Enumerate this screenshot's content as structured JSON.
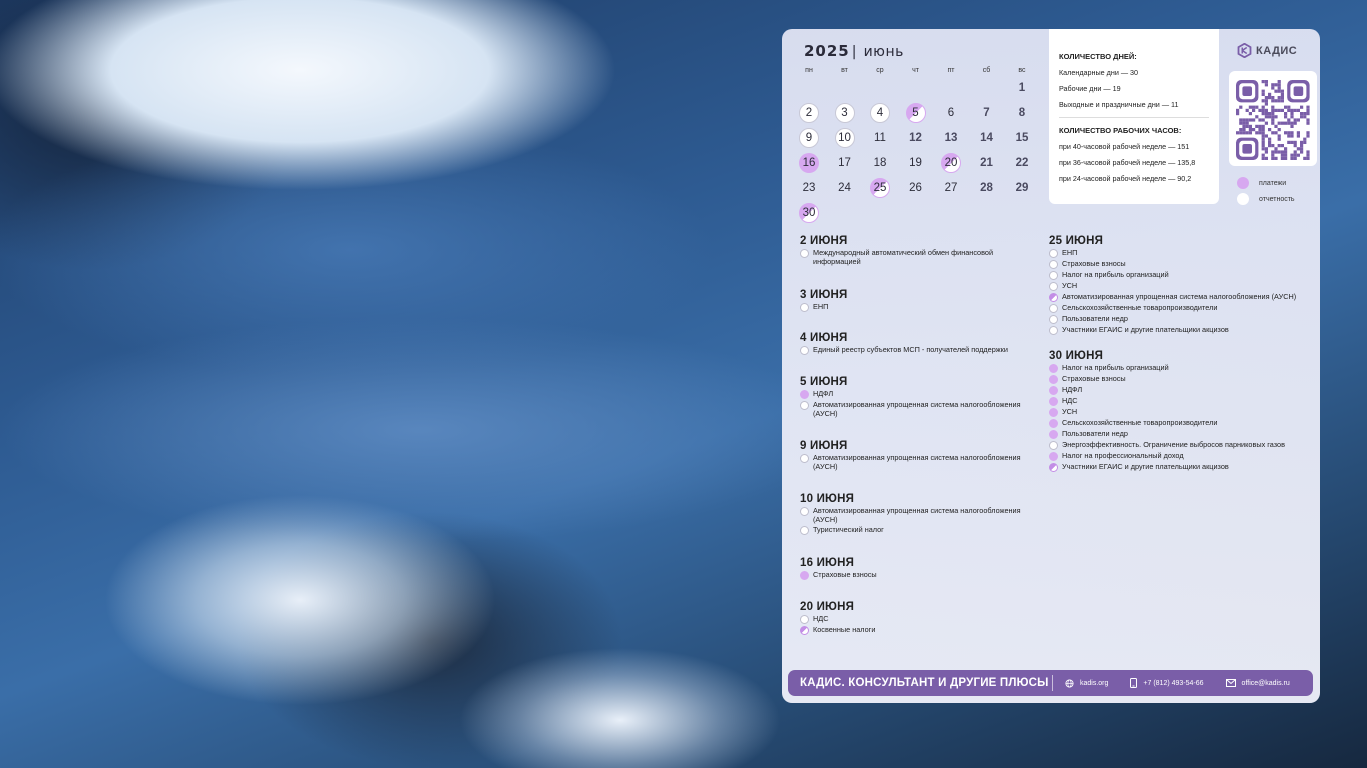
{
  "calendar": {
    "year": "2025",
    "month": "июнь",
    "weekdays": [
      "пн",
      "вт",
      "ср",
      "чт",
      "пт",
      "сб",
      "вс"
    ],
    "days": [
      {
        "d": "1",
        "col": 6,
        "row": 0,
        "mark": "",
        "weekend": true
      },
      {
        "d": "2",
        "col": 0,
        "row": 1,
        "mark": "report",
        "weekend": false
      },
      {
        "d": "3",
        "col": 1,
        "row": 1,
        "mark": "report",
        "weekend": false
      },
      {
        "d": "4",
        "col": 2,
        "row": 1,
        "mark": "report",
        "weekend": false
      },
      {
        "d": "5",
        "col": 3,
        "row": 1,
        "mark": "half",
        "weekend": false
      },
      {
        "d": "6",
        "col": 4,
        "row": 1,
        "mark": "",
        "weekend": false
      },
      {
        "d": "7",
        "col": 5,
        "row": 1,
        "mark": "",
        "weekend": true
      },
      {
        "d": "8",
        "col": 6,
        "row": 1,
        "mark": "",
        "weekend": true
      },
      {
        "d": "9",
        "col": 0,
        "row": 2,
        "mark": "report",
        "weekend": false
      },
      {
        "d": "10",
        "col": 1,
        "row": 2,
        "mark": "report",
        "weekend": false
      },
      {
        "d": "11",
        "col": 2,
        "row": 2,
        "mark": "",
        "weekend": false
      },
      {
        "d": "12",
        "col": 3,
        "row": 2,
        "mark": "",
        "weekend": true
      },
      {
        "d": "13",
        "col": 4,
        "row": 2,
        "mark": "",
        "weekend": true
      },
      {
        "d": "14",
        "col": 5,
        "row": 2,
        "mark": "",
        "weekend": true
      },
      {
        "d": "15",
        "col": 6,
        "row": 2,
        "mark": "",
        "weekend": true
      },
      {
        "d": "16",
        "col": 0,
        "row": 3,
        "mark": "pay",
        "weekend": false
      },
      {
        "d": "17",
        "col": 1,
        "row": 3,
        "mark": "",
        "weekend": false
      },
      {
        "d": "18",
        "col": 2,
        "row": 3,
        "mark": "",
        "weekend": false
      },
      {
        "d": "19",
        "col": 3,
        "row": 3,
        "mark": "",
        "weekend": false
      },
      {
        "d": "20",
        "col": 4,
        "row": 3,
        "mark": "half",
        "weekend": false
      },
      {
        "d": "21",
        "col": 5,
        "row": 3,
        "mark": "",
        "weekend": true
      },
      {
        "d": "22",
        "col": 6,
        "row": 3,
        "mark": "",
        "weekend": true
      },
      {
        "d": "23",
        "col": 0,
        "row": 4,
        "mark": "",
        "weekend": false
      },
      {
        "d": "24",
        "col": 1,
        "row": 4,
        "mark": "",
        "weekend": false
      },
      {
        "d": "25",
        "col": 2,
        "row": 4,
        "mark": "half",
        "weekend": false
      },
      {
        "d": "26",
        "col": 3,
        "row": 4,
        "mark": "",
        "weekend": false
      },
      {
        "d": "27",
        "col": 4,
        "row": 4,
        "mark": "",
        "weekend": false
      },
      {
        "d": "28",
        "col": 5,
        "row": 4,
        "mark": "",
        "weekend": true
      },
      {
        "d": "29",
        "col": 6,
        "row": 4,
        "mark": "",
        "weekend": true
      },
      {
        "d": "30",
        "col": 0,
        "row": 5,
        "mark": "half",
        "weekend": false
      }
    ]
  },
  "info": {
    "days_title": "КОЛИЧЕСТВО ДНЕЙ:",
    "calendar_days": "Календарные дни — 30",
    "work_days": "Рабочие дни — 19",
    "holidays": "Выходные и праздничные дни — 11",
    "hours_title": "КОЛИЧЕСТВО РАБОЧИХ ЧАСОВ:",
    "h40": "при 40-часовой рабочей неделе — 151",
    "h36": "при 36-часовой рабочей неделе — 135,8",
    "h24": "при 24-часовой рабочей неделе — 90,2"
  },
  "brand": {
    "logo": "КАДИС",
    "accent": "#7a5ea8",
    "pay_color": "#d7a8f0"
  },
  "legend": {
    "payments": "платежи",
    "reports": "отчетность"
  },
  "events_left": [
    {
      "date": "2 ИЮНЯ",
      "items": [
        {
          "t": "Международный автоматический обмен финансовой информацией",
          "m": "r"
        }
      ]
    },
    {
      "date": "3 ИЮНЯ",
      "items": [
        {
          "t": "ЕНП",
          "m": "r"
        }
      ]
    },
    {
      "date": "4 ИЮНЯ",
      "items": [
        {
          "t": "Единый реестр субъектов МСП - получателей поддержки",
          "m": "r"
        }
      ]
    },
    {
      "date": "5 ИЮНЯ",
      "items": [
        {
          "t": "НДФЛ",
          "m": "p"
        },
        {
          "t": "Автоматизированная упрощенная система налогообложения (АУСН)",
          "m": "r"
        }
      ]
    },
    {
      "date": "9 ИЮНЯ",
      "items": [
        {
          "t": "Автоматизированная упрощенная система налогообложения (АУСН)",
          "m": "r"
        }
      ]
    },
    {
      "date": "10 ИЮНЯ",
      "items": [
        {
          "t": "Автоматизированная упрощенная система налогообложения (АУСН)",
          "m": "r"
        },
        {
          "t": "Туристический налог",
          "m": "r"
        }
      ]
    },
    {
      "date": "16 ИЮНЯ",
      "items": [
        {
          "t": "Страховые взносы",
          "m": "p"
        }
      ]
    },
    {
      "date": "20 ИЮНЯ",
      "items": [
        {
          "t": "НДС",
          "m": "r"
        },
        {
          "t": "Косвенные налоги",
          "m": "h"
        }
      ]
    }
  ],
  "events_right": [
    {
      "date": "25 ИЮНЯ",
      "items": [
        {
          "t": "ЕНП",
          "m": "r"
        },
        {
          "t": "Страховые взносы",
          "m": "r"
        },
        {
          "t": "Налог на прибыль организаций",
          "m": "r"
        },
        {
          "t": "УСН",
          "m": "r"
        },
        {
          "t": "Автоматизированная упрощенная система налогообложения (АУСН)",
          "m": "h"
        },
        {
          "t": "Сельскохозяйственные товаропроизводители",
          "m": "r"
        },
        {
          "t": "Пользователи недр",
          "m": "r"
        },
        {
          "t": "Участники ЕГАИС и другие плательщики акцизов",
          "m": "r"
        }
      ]
    },
    {
      "date": "30 ИЮНЯ",
      "items": [
        {
          "t": "Налог на прибыль организаций",
          "m": "p"
        },
        {
          "t": "Страховые взносы",
          "m": "p"
        },
        {
          "t": "НДФЛ",
          "m": "p"
        },
        {
          "t": "НДС",
          "m": "p"
        },
        {
          "t": "УСН",
          "m": "p"
        },
        {
          "t": "Сельскохозяйственные товаропроизводители",
          "m": "p"
        },
        {
          "t": "Пользователи недр",
          "m": "p"
        },
        {
          "t": "Энергоэффективность. Ограничение выбросов парниковых газов",
          "m": "r"
        },
        {
          "t": "Налог на профессиональный доход",
          "m": "p"
        },
        {
          "t": "Участники ЕГАИС и другие плательщики акцизов",
          "m": "h"
        }
      ]
    }
  ],
  "footer": {
    "brand": "КАДИС. КОНСУЛЬТАНТ И ДРУГИЕ ПЛЮСЫ",
    "site": "kadis.org",
    "phone": "+7 (812) 493-54-66",
    "email": "office@kadis.ru"
  }
}
